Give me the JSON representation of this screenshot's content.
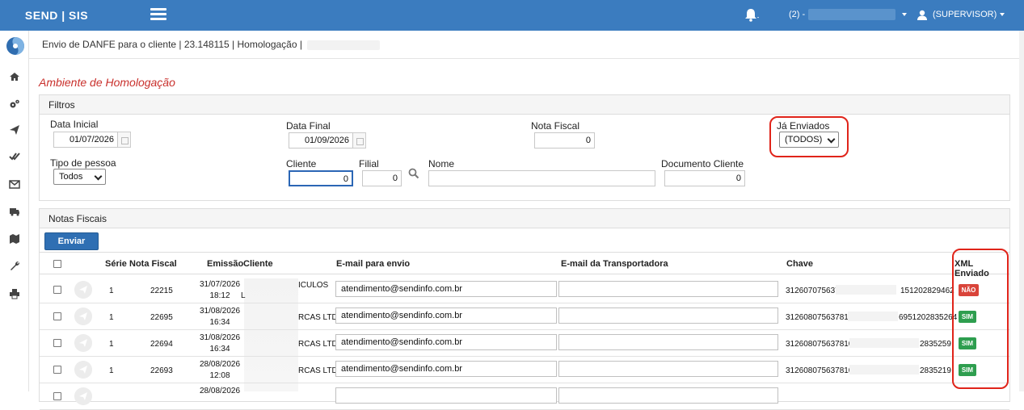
{
  "app": {
    "brand": "SEND | SIS"
  },
  "topbar": {
    "branch_prefix": "(2) -",
    "user_label": "(SUPERVISOR)"
  },
  "breadcrumb": {
    "text": "Envio de DANFE para o cliente | 23.148115 | Homologação |"
  },
  "environment_title": "Ambiente de Homologação",
  "filters": {
    "title": "Filtros",
    "data_inicial": {
      "label": "Data Inicial",
      "value": "01/07/2026"
    },
    "data_final": {
      "label": "Data Final",
      "value": "01/09/2026"
    },
    "nota_fiscal": {
      "label": "Nota Fiscal",
      "value": "0"
    },
    "ja_enviados": {
      "label": "Já Enviados",
      "value": "(TODOS)"
    },
    "tipo_pessoa": {
      "label": "Tipo de pessoa",
      "value": "Todos"
    },
    "cliente": {
      "label": "Cliente",
      "value": "0"
    },
    "filial": {
      "label": "Filial",
      "value": "0"
    },
    "nome": {
      "label": "Nome",
      "value": ""
    },
    "documento_cliente": {
      "label": "Documento Cliente",
      "value": "0"
    }
  },
  "notas": {
    "title": "Notas Fiscais",
    "send_button": "Enviar",
    "columns": {
      "serie": "Série",
      "nota_fiscal": "Nota Fiscal",
      "emissao": "Emissão",
      "cliente": "Cliente",
      "email_envio": "E-mail para envio",
      "email_transportadora": "E-mail da Transportadora",
      "chave": "Chave",
      "xml_enviado": "XML Enviado"
    },
    "rows": [
      {
        "serie": "1",
        "nota": "22215",
        "date": "31/07/2026",
        "time": "18:12",
        "cliente": "ICULOS",
        "cliente2": "L",
        "email": "atendimento@sendinfo.com.br",
        "transp": "",
        "chave_a": "3126070756378",
        "chave_b": "151202829462",
        "xml": "NÃO",
        "xml_status": "nao"
      },
      {
        "serie": "1",
        "nota": "22695",
        "date": "31/08/2026",
        "time": "16:34",
        "cliente": "RCAS LTDA",
        "cliente2": "",
        "email": "atendimento@sendinfo.com.br",
        "transp": "",
        "chave_a": "312608075637810",
        "chave_b": "69512028352​64",
        "xml": "SIM",
        "xml_status": "sim"
      },
      {
        "serie": "1",
        "nota": "22694",
        "date": "31/08/2026",
        "time": "16:34",
        "cliente": "RCAS LTDA",
        "cliente2": "",
        "email": "atendimento@sendinfo.com.br",
        "transp": "",
        "chave_a": "3126080756378100",
        "chave_b": "2835259",
        "xml": "SIM",
        "xml_status": "sim"
      },
      {
        "serie": "1",
        "nota": "22693",
        "date": "28/08/2026",
        "time": "12:08",
        "cliente": "RCAS LTDA",
        "cliente2": "",
        "email": "atendimento@sendinfo.com.br",
        "transp": "",
        "chave_a": "3126080756378100",
        "chave_b": "2835219",
        "xml": "SIM",
        "xml_status": "sim"
      },
      {
        "serie": "",
        "nota": "",
        "date": "28/08/2026",
        "time": "",
        "cliente": "",
        "cliente2": "",
        "email": "",
        "transp": "",
        "chave_a": "",
        "chave_b": "",
        "xml": "",
        "xml_status": ""
      }
    ]
  },
  "icons": [
    "menu-icon",
    "bell-icon",
    "user-icon",
    "home-icon",
    "gears-icon",
    "send-icon",
    "double-check-icon",
    "envelope-icon",
    "truck-icon",
    "map-icon",
    "wrench-icon",
    "print-icon",
    "search-icon",
    "calendar-icon"
  ]
}
